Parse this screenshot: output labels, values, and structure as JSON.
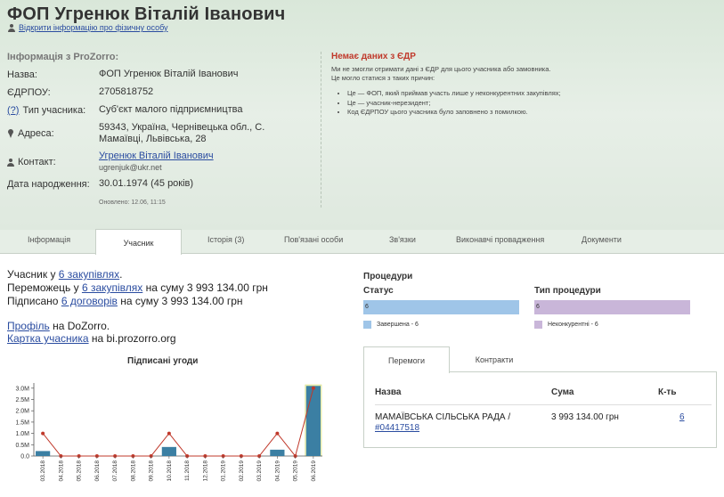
{
  "header": {
    "title": "ФОП Угренюк Віталій Іванович",
    "person_link": "Відкрити інформацію про фізичну особу",
    "section_title": "Інформація з ProZorro:",
    "fields": {
      "name_label": "Назва:",
      "name_value": "ФОП Угренюк Віталій Іванович",
      "edrpou_label": "ЄДРПОУ:",
      "edrpou_value": "2705818752",
      "type_help": "(?)",
      "type_label": "Тип учасника:",
      "type_value": "Суб'єкт малого підприємництва",
      "address_label": "Адреса:",
      "address_value": "59343, Україна, Чернівецька обл., С. Мамаївці, Львівська, 28",
      "contact_label": "Контакт:",
      "contact_name": "Угренюк Віталій Іванович",
      "contact_email": "ugrenjuk@ukr.net",
      "birth_label": "Дата народження:",
      "birth_value": "30.01.1974 (45 років)"
    },
    "updated": "Оновлено: 12.06, 11:15",
    "edr": {
      "title": "Немає даних з ЄДР",
      "text1": "Ми не змогли отримати дані з ЄДР для цього учасника або замовника.",
      "text2": "Це могло статися з таких причин:",
      "reasons": [
        "Це — ФОП, який приймав участь лише у неконкурентних закупівлях;",
        "Це — учасник-нерезидент;",
        "Код ЄДРПОУ цього учасника було заповнено з помилкою."
      ]
    }
  },
  "tabs": [
    "Інформація",
    "Учасник",
    "Історія (3)",
    "Пов'язані особи",
    "Зв'язки",
    "Виконавчі провадження",
    "Документи"
  ],
  "summary": {
    "line1_pre": "Учасник у ",
    "line1_link": "6 закупівлях",
    "line1_post": ".",
    "line2_pre": "Переможець у ",
    "line2_link": "6 закупівлях",
    "line2_post": " на суму 3 993 134.00 грн",
    "line3_pre": "Підписано ",
    "line3_link": "6 договорів",
    "line3_post": " на суму 3 993 134.00 грн",
    "profile_link": "Профіль",
    "profile_post": " на DoZorro.",
    "card_link": "Картка учасника",
    "card_post": " на bi.prozorro.org"
  },
  "chart_data": {
    "type": "bar",
    "title": "Підписані угоди",
    "categories": [
      "03.2018",
      "04.2018",
      "05.2018",
      "06.2018",
      "07.2018",
      "08.2018",
      "09.2018",
      "10.2018",
      "11.2018",
      "12.2018",
      "01.2019",
      "02.2019",
      "03.2019",
      "04.2019",
      "05.2019",
      "06.2019"
    ],
    "series": [
      {
        "type": "bar",
        "values": [
          0.22,
          0,
          0,
          0,
          0,
          0,
          0,
          0.4,
          0,
          0,
          0,
          0,
          0,
          0.28,
          0,
          3.1
        ],
        "color": "#3b7fa3"
      },
      {
        "type": "line",
        "values": [
          1,
          0,
          0,
          0,
          0,
          0,
          0,
          1,
          0,
          0,
          0,
          0,
          0,
          1,
          0,
          3
        ],
        "color": "#c0392b"
      }
    ],
    "yticks": [
      "0.0",
      "0.5M",
      "1.0M",
      "1.5M",
      "2.0M",
      "2.5M",
      "3.0M"
    ],
    "ylim": [
      0,
      3.15
    ],
    "highlight_index": 15
  },
  "procedures": {
    "title": "Процедури",
    "status_label": "Статус",
    "status_bar_value": "6",
    "status_legend": "Завершена - 6",
    "type_label": "Тип процедури",
    "type_bar_value": "6",
    "type_legend": "Неконкурентні - 6",
    "colors": {
      "status": "#9fc5e8",
      "type": "#c9b6d9"
    }
  },
  "wins": {
    "tabs": [
      "Перемоги",
      "Контракти"
    ],
    "headers": {
      "name": "Назва",
      "sum": "Сума",
      "count": "К-ть"
    },
    "rows": [
      {
        "name": "МАМАЇВСЬКА СІЛЬСЬКА РАДА /",
        "code": "#04417518",
        "sum": "3 993 134.00 грн",
        "count": "6"
      }
    ]
  }
}
